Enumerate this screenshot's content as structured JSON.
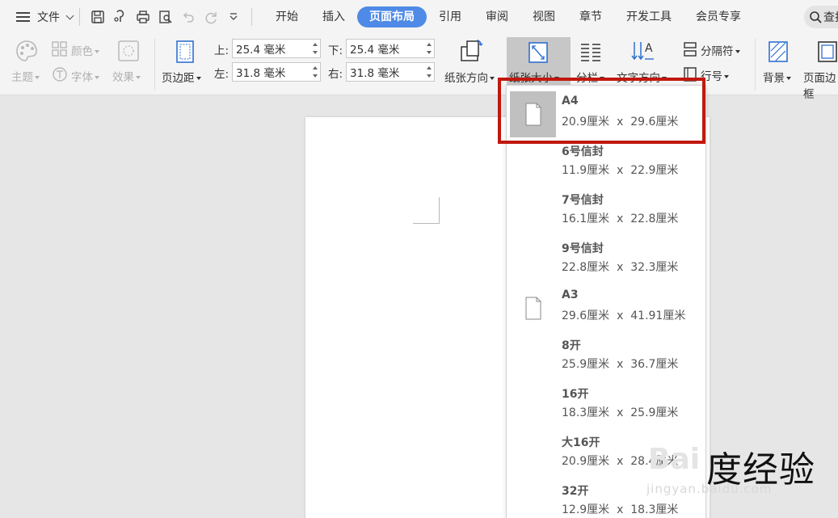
{
  "menubar": {
    "file_label": "文件",
    "tabs": [
      {
        "label": "开始",
        "active": false
      },
      {
        "label": "插入",
        "active": false
      },
      {
        "label": "页面布局",
        "active": true
      },
      {
        "label": "引用",
        "active": false
      },
      {
        "label": "审阅",
        "active": false
      },
      {
        "label": "视图",
        "active": false
      },
      {
        "label": "章节",
        "active": false
      },
      {
        "label": "开发工具",
        "active": false
      },
      {
        "label": "会员专享",
        "active": false
      }
    ],
    "search_label": "查找"
  },
  "ribbon": {
    "theme_label": "主题",
    "color_label": "颜色",
    "font_label": "字体",
    "effect_label": "效果",
    "margin_label": "页边距",
    "top_label": "上:",
    "top_value": "25.4 毫米",
    "bottom_label": "下:",
    "bottom_value": "25.4 毫米",
    "left_label": "左:",
    "left_value": "31.8 毫米",
    "right_label": "右:",
    "right_value": "31.8 毫米",
    "orientation_label": "纸张方向",
    "paper_size_label": "纸张大小",
    "columns_label": "分栏",
    "text_direction_label": "文字方向",
    "separator_label": "分隔符",
    "line_number_label": "行号",
    "background_label": "背景",
    "page_border_label": "页面边框"
  },
  "paper_sizes": [
    {
      "name": "A4",
      "dims": "20.9厘米  x  29.6厘米",
      "selected": true
    },
    {
      "name": "6号信封",
      "dims": "11.9厘米  x  22.9厘米",
      "selected": false
    },
    {
      "name": "7号信封",
      "dims": "16.1厘米  x  22.8厘米",
      "selected": false
    },
    {
      "name": "9号信封",
      "dims": "22.8厘米  x  32.3厘米",
      "selected": false
    },
    {
      "name": "A3",
      "dims": "29.6厘米  x  41.91厘米",
      "selected": false
    },
    {
      "name": "8开",
      "dims": "25.9厘米  x  36.7厘米",
      "selected": false
    },
    {
      "name": "16开",
      "dims": "18.3厘米  x  25.9厘米",
      "selected": false
    },
    {
      "name": "大16开",
      "dims": "20.9厘米  x  28.4厘米",
      "selected": false
    },
    {
      "name": "32开",
      "dims": "12.9厘米  x  18.3厘米",
      "selected": false
    }
  ],
  "watermark": {
    "brand": "Bai",
    "text": "度经验",
    "url": "jingyan.baidu.com"
  },
  "colors": {
    "accent": "#4e8ae6",
    "highlight": "#c0180f",
    "selected_bg": "#c0c0c0"
  }
}
